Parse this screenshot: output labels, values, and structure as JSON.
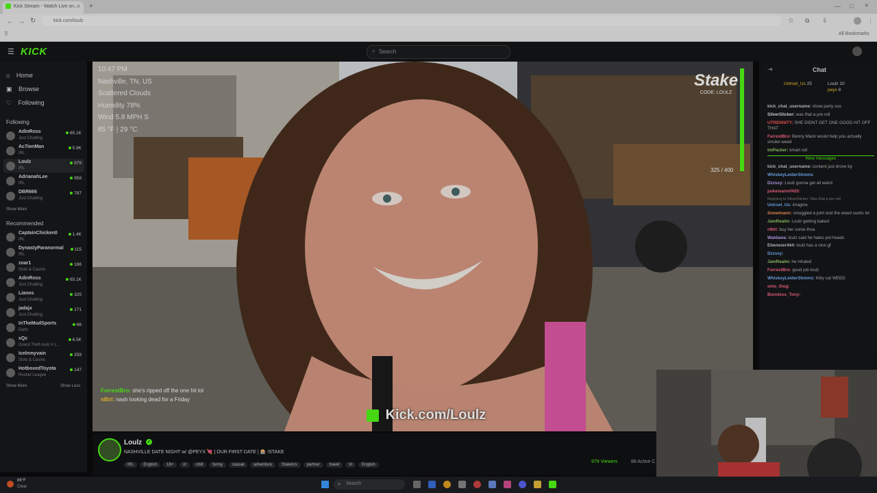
{
  "browser": {
    "tab_title": "Kick Stream - Watch Live on...",
    "url": "kick.com/loulz",
    "bookmarks_label": "All Bookmarks"
  },
  "header": {
    "logo": "KICK",
    "search_placeholder": "Search"
  },
  "sidebar": {
    "nav": [
      {
        "label": "Home"
      },
      {
        "label": "Browse"
      },
      {
        "label": "Following"
      }
    ],
    "following_title": "Following",
    "following": [
      {
        "name": "AdinRoss",
        "category": "Just Chatting",
        "viewers": "65.1K"
      },
      {
        "name": "Ac7ionMan",
        "category": "IRL",
        "viewers": "5.9K"
      },
      {
        "name": "Loulz",
        "category": "IRL",
        "viewers": "979"
      },
      {
        "name": "AdrianahLee",
        "category": "IRL",
        "viewers": "958"
      },
      {
        "name": "DBR666",
        "category": "Just Chatting",
        "viewers": "787"
      }
    ],
    "show_more": "Show More",
    "recommended_title": "Recommended",
    "recommended": [
      {
        "name": "CaptainChicken0",
        "category": "IRL",
        "viewers": "1.4K"
      },
      {
        "name": "DynastyParanormal",
        "category": "IRL",
        "viewers": "115"
      },
      {
        "name": "zoar1",
        "category": "Slots & Casino",
        "viewers": "166"
      },
      {
        "name": "AdinRoss",
        "category": "Just Chatting",
        "viewers": "65.1K"
      },
      {
        "name": "Lianos",
        "category": "Just Chatting",
        "viewers": "325"
      },
      {
        "name": "jadajx",
        "category": "Just Chatting",
        "viewers": "171"
      },
      {
        "name": "InTheMudSports",
        "category": "Darts",
        "viewers": "66"
      },
      {
        "name": "xQc",
        "category": "Grand Theft Auto V (...",
        "viewers": "6.5K"
      },
      {
        "name": "Icelnmyvain",
        "category": "Slots & Casino",
        "viewers": "259"
      },
      {
        "name": "HotboxedToyota",
        "category": "Rocket League",
        "viewers": "147"
      }
    ],
    "show_more_2": "Show More",
    "show_less": "Show Less"
  },
  "overlay": {
    "weather": [
      "10:47 PM",
      "Nashville, TN, US",
      "Scattered Clouds",
      "Humidity 78%",
      "Wind 5.8 MPH S",
      "85 °F | 29 °C"
    ],
    "stake_brand": "Stake",
    "stake_sub": "CODE: LOULZ",
    "goal": "325 / 400",
    "chat_overlay": [
      {
        "user": "ForrestBro:",
        "text": "she's ripped off the one hit lol"
      },
      {
        "user": "n8trl:",
        "text": "nash looking dead for a Friday"
      }
    ],
    "watermark": "Kick.com/Loulz"
  },
  "stream": {
    "streamer": "Loulz",
    "title": "NASHVILLE DATE NIGHT w/ @PEYX 💘 | OUR FIRST DATE | 🎰 !STAKE",
    "tags": [
      "IRL",
      "English",
      "18+",
      "irl",
      "chill",
      "funny",
      "casual",
      "adventure",
      "StakeUs",
      "partner",
      "travel",
      "irl",
      "English"
    ],
    "viewers": "979 Viewers",
    "active": "88 Active C"
  },
  "chat": {
    "title": "Chat",
    "pinned": [
      {
        "user": "Unlrsel_Us",
        "count": "25"
      },
      {
        "user": "Loulz",
        "count": "10"
      },
      {
        "user": "peyx",
        "count": "8"
      }
    ],
    "messages": [
      {
        "user": "kick_chat_username:",
        "text": "show party ous",
        "color": "#cfcfcf"
      },
      {
        "user": "SilverSlicker:",
        "text": "was that a pre roll",
        "color": "#e8e8e8"
      },
      {
        "user": "UTRENNITY:",
        "text": "SHE DIDNT GET ONE GOOD HIT OFF THAT",
        "color": "#ff5a5a"
      },
      {
        "user": "FarrestBro:",
        "text": "Benny Mack would help you actually smoke weed",
        "color": "#ff6b8a"
      },
      {
        "user": "tmPacker:",
        "text": "kmart roll",
        "color": "#9ad16a"
      },
      {
        "user": "kick_chat_username:",
        "text": "content just drove by",
        "color": "#cfcfcf"
      },
      {
        "user": "WhiskeyLeiderShmmz",
        "text": "",
        "color": "#78b6ff"
      },
      {
        "user": "Dzzssy:",
        "text": "Loulz gonna get all weird",
        "color": "#c9a8ff"
      },
      {
        "user": "pokemanmf420:",
        "text": "",
        "color": "#ff6b8a"
      },
      {
        "user": "Unlrsel_Us:",
        "text": "imagine",
        "color": "#78b6ff"
      },
      {
        "user": "Snowmann:",
        "text": "smuggled a joint and the weed sucks lol",
        "color": "#ff9a5a"
      },
      {
        "user": "JamRealm:",
        "text": "Loulz getting baked",
        "color": "#9ad16a"
      },
      {
        "user": "n8trl:",
        "text": "buy her some thca",
        "color": "#ff6b8a"
      },
      {
        "user": "Waldawa:",
        "text": "louiz said he hates pot heads",
        "color": "#c9a8ff"
      },
      {
        "user": "Ebenezer444:",
        "text": "loulz has a nice gf",
        "color": "#cfcfcf"
      },
      {
        "user": "Dzzssy:",
        "text": "",
        "color": "#78b6ff"
      },
      {
        "user": "JamRealm:",
        "text": "he inhaled",
        "color": "#9ad16a"
      },
      {
        "user": "ForrestBro:",
        "text": "good job loulz",
        "color": "#ff6b8a"
      },
      {
        "user": "WhiskeyLeiderShmmz:",
        "text": "Kitty cat WEED",
        "color": "#78b6ff"
      },
      {
        "user": "omo_thug:",
        "text": "",
        "color": "#ff6b8a"
      },
      {
        "user": "Bunsless_Tony:",
        "text": "",
        "color": "#ff6b8a"
      }
    ],
    "new_messages": "New messages",
    "reply_hint": "Replying to SilverSlicker: Was that a pre roll"
  },
  "taskbar": {
    "weather_temp": "86°F",
    "weather_desc": "Clear",
    "search_placeholder": "Search"
  },
  "colors": {
    "kick_green": "#53fc18",
    "dark_bg": "#0b0b0c"
  }
}
